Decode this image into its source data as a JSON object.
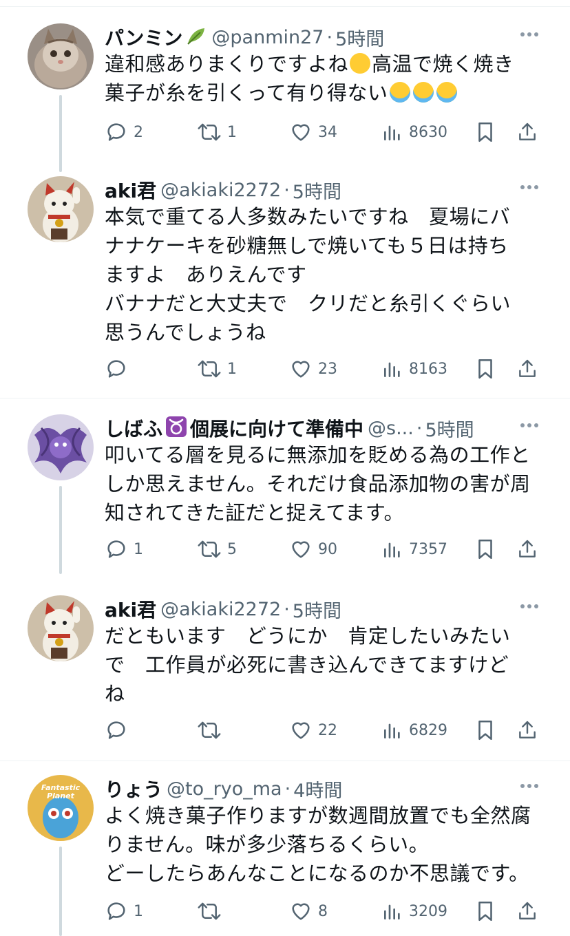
{
  "tweets": [
    {
      "name": "パンミン",
      "name_badge": "leaf-icon",
      "handle": "@panmin27",
      "time": "5時間",
      "text_lines": [
        "違和感ありまくりですよね",
        "高温で焼く焼き",
        "菓子が糸を引くって有り得ない"
      ],
      "emojis": [
        "eye-roll-emoji",
        "laughing-crying-emoji",
        "laughing-crying-emoji",
        "laughing-crying-emoji"
      ],
      "reply": "2",
      "retweet": "1",
      "like": "34",
      "views": "8630",
      "avatar": "cat"
    },
    {
      "name": "aki君",
      "handle": "@akiaki2272",
      "time": "5時間",
      "text": "本気で重てる人多数みたいですね　夏場にバ\nナナケーキを砂糖無しで焼いても５日は持ち\nますよ　ありえんです\nバナナだと大丈夫で　クリだと糸引くぐらい\n思うんでしょうね",
      "reply": "",
      "retweet": "1",
      "like": "23",
      "views": "8163",
      "avatar": "maneki-neko"
    },
    {
      "name": "しばふ",
      "name_badge": "taurus-icon",
      "name_suffix": "個展に向けて準備中",
      "handle": "@s...",
      "time": "5時間",
      "text": "叩いてる層を見るに無添加を貶める為の工作と\nしか思えません。それだけ食品添加物の害が周\n知されてきた証だと捉えてます。",
      "reply": "1",
      "retweet": "5",
      "like": "90",
      "views": "7357",
      "avatar": "dragon"
    },
    {
      "name": "aki君",
      "handle": "@akiaki2272",
      "time": "5時間",
      "text": "だともいます　どうにか　肯定したいみたい\nで　工作員が必死に書き込んできてますけど\nね",
      "reply": "",
      "retweet": "",
      "like": "22",
      "views": "6829",
      "avatar": "maneki-neko"
    },
    {
      "name": "りょう",
      "handle": "@to_ryo_ma",
      "time": "4時間",
      "text": "よく焼き菓子作りますが数週間放置でも全然腐\nりません。味が多少落ちるくらい。\nどーしたらあんなことになるのか不思議です。",
      "reply": "1",
      "retweet": "",
      "like": "8",
      "views": "3209",
      "avatar": "fantastic-planet",
      "avatar_text": "Fantastic Planet"
    }
  ],
  "colors": {
    "text": "#0f1419",
    "secondary": "#536471",
    "divider": "#eff3f4",
    "thread": "#cfd9de"
  }
}
